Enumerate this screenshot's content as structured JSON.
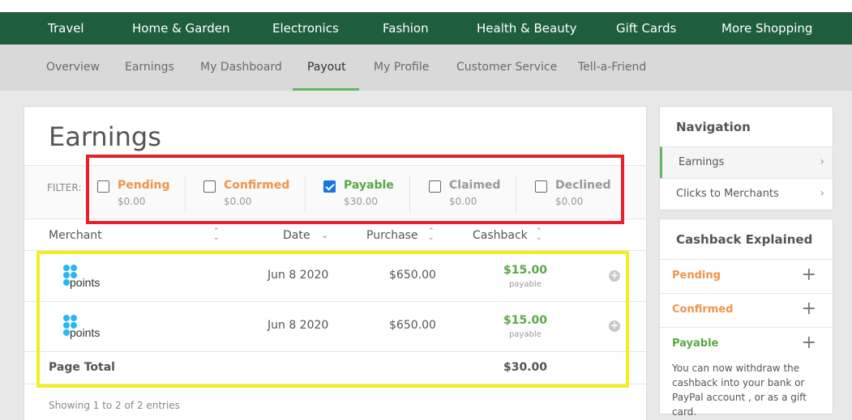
{
  "category_nav": [
    "Travel",
    "Home & Garden",
    "Electronics",
    "Fashion",
    "Health & Beauty",
    "Gift Cards",
    "More Shopping"
  ],
  "sub_nav": {
    "items": [
      "Overview",
      "Earnings",
      "My Dashboard",
      "Payout",
      "My Profile",
      "Customer Service",
      "Tell-a-Friend"
    ],
    "active": "Payout"
  },
  "earnings": {
    "title": "Earnings",
    "filter_label": "FILTER:",
    "filters": [
      {
        "name": "Pending",
        "amount": "$0.00",
        "checked": false,
        "color": "#f0954a"
      },
      {
        "name": "Confirmed",
        "amount": "$0.00",
        "checked": false,
        "color": "#f0954a"
      },
      {
        "name": "Payable",
        "amount": "$30.00",
        "checked": true,
        "color": "#5aa845"
      },
      {
        "name": "Claimed",
        "amount": "$0.00",
        "checked": false,
        "color": "#999999"
      },
      {
        "name": "Declined",
        "amount": "$0.00",
        "checked": false,
        "color": "#999999"
      }
    ],
    "columns": {
      "merchant": "Merchant",
      "date": "Date",
      "purchase": "Purchase",
      "cashback": "Cashback"
    },
    "rows": [
      {
        "merchant_logo_text": "points",
        "date": "Jun 8 2020",
        "purchase": "$650.00",
        "cashback": "$15.00",
        "cashback_status": "payable"
      },
      {
        "merchant_logo_text": "points",
        "date": "Jun 8 2020",
        "purchase": "$650.00",
        "cashback": "$15.00",
        "cashback_status": "payable"
      }
    ],
    "page_total_label": "Page Total",
    "page_total": "$30.00",
    "showing": "Showing 1 to 2 of 2 entries"
  },
  "navigation": {
    "title": "Navigation",
    "items": [
      "Earnings",
      "Clicks to Merchants"
    ]
  },
  "cashback_explained": {
    "title": "Cashback Explained",
    "items": [
      {
        "name": "Pending",
        "color": "#f0954a"
      },
      {
        "name": "Confirmed",
        "color": "#f0954a"
      },
      {
        "name": "Payable",
        "color": "#5aa845"
      }
    ],
    "payable_description": "You can now withdraw the cashback into your bank or PayPal account , or as a gift card."
  },
  "highlight_colors": {
    "red": "#e8202a",
    "yellow": "#f4ee1d"
  }
}
